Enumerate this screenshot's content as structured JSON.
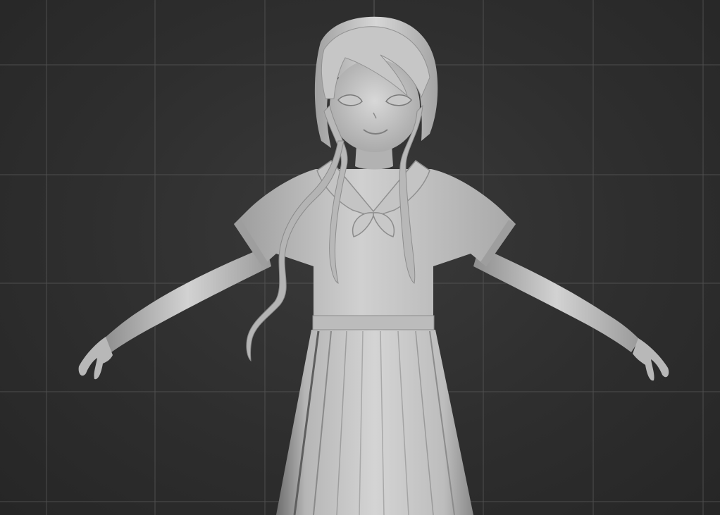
{
  "viewport": {
    "name": "3d-perspective-viewport",
    "background_color": "#2d2d2d",
    "grid_color": "#5a5a5a",
    "model_color": "#c8c8c8",
    "show_grid": true
  },
  "model": {
    "name": "character-mesh",
    "pose": "T-pose",
    "shading": "clay"
  }
}
